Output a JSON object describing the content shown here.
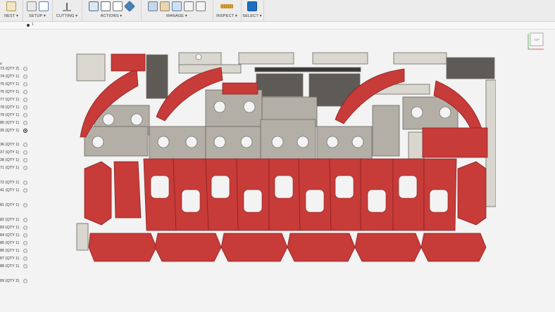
{
  "toolbar": {
    "groups": [
      {
        "label": "NEST ▾",
        "icons": [
          "nest-icon"
        ]
      },
      {
        "label": "SETUP ▾",
        "icons": [
          "folder-icon",
          "setup-icon"
        ]
      },
      {
        "label": "CUTTING ▾",
        "icons": [
          "cutting-icon"
        ]
      },
      {
        "label": "ACTIONS ▾",
        "icons": [
          "download-icon",
          "list-icon",
          "document-icon",
          "cube-icon"
        ]
      },
      {
        "label": "MANAGE ▾",
        "icons": [
          "layers-icon",
          "tools-icon",
          "image-icon",
          "copy-icon",
          "file-icon"
        ]
      },
      {
        "label": "INSPECT ▾",
        "icons": [
          "ruler-icon"
        ]
      },
      {
        "label": "SELECT ▾",
        "icons": [
          "cursor-icon"
        ]
      }
    ]
  },
  "subbar": {
    "index": "1"
  },
  "browser": {
    "header": "s",
    "rows": [
      {
        "label": "73 (QTY 2)",
        "active": false
      },
      {
        "label": "74 (QTY 1)",
        "active": false
      },
      {
        "label": "75 (QTY 1)",
        "active": false
      },
      {
        "label": "76 (QTY 1)",
        "active": false
      },
      {
        "label": "77 (QTY 1)",
        "active": false
      },
      {
        "label": "78 (QTY 1)",
        "active": false
      },
      {
        "label": "79 (QTY 1)",
        "active": false
      },
      {
        "label": "80 (QTY 1)",
        "active": false
      },
      {
        "label": "35 (QTY 1)",
        "active": true
      },
      {
        "label": "36 (QTY 1)",
        "active": false
      },
      {
        "label": "37 (QTY 1)",
        "active": false
      },
      {
        "label": "38 (QTY 1)",
        "active": false
      },
      {
        "label": "71 (QTY 1)",
        "active": false
      },
      {
        "label": "72 (QTY 1)",
        "active": false
      },
      {
        "label": "41 (QTY 1)",
        "active": false
      },
      {
        "label": "81 (QTY 1)",
        "active": false
      },
      {
        "label": "82 (QTY 1)",
        "active": false
      },
      {
        "label": "83 (QTY 1)",
        "active": false
      },
      {
        "label": "84 (QTY 1)",
        "active": false
      },
      {
        "label": "85 (QTY 1)",
        "active": false
      },
      {
        "label": "86 (QTY 1)",
        "active": false
      },
      {
        "label": "87 (QTY 1)",
        "active": false
      },
      {
        "label": "88 (QTY 1)",
        "active": false
      },
      {
        "label": "89 (QTY 2)",
        "active": false
      }
    ]
  },
  "colors": {
    "red": "#c73b38",
    "grey": "#b3afa7",
    "light": "#dad7d1",
    "dark": "#5e5a56"
  },
  "viewcube": {
    "face": "TOP"
  }
}
